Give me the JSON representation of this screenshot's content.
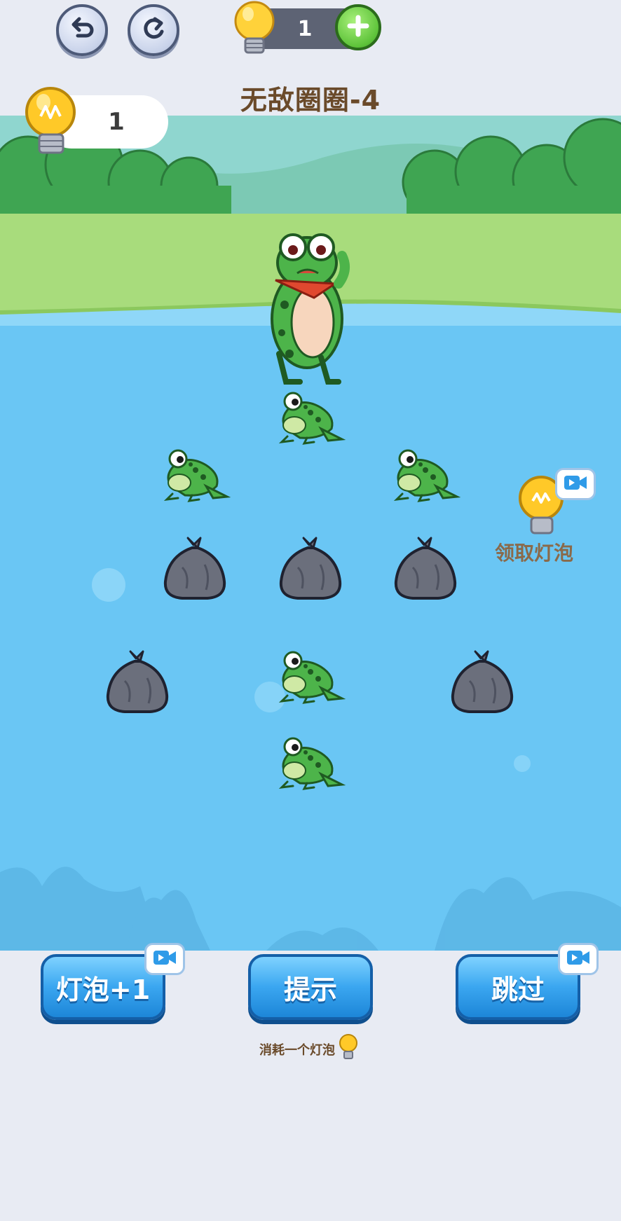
{
  "top_bar": {
    "undo_icon": "undo-arrow-icon",
    "redo_icon": "redo-arrow-icon",
    "bulb_count": "1",
    "add_icon": "plus-icon"
  },
  "level": {
    "title": "无敌圈圈-4"
  },
  "bulb_panel": {
    "count": "1",
    "icon": "lightbulb-icon"
  },
  "board": {
    "pieces": [
      {
        "kind": "frog"
      },
      {
        "kind": "frog"
      },
      {
        "kind": "frog"
      },
      {
        "kind": "bag"
      },
      {
        "kind": "bag"
      },
      {
        "kind": "bag"
      },
      {
        "kind": "bag"
      },
      {
        "kind": "frog"
      },
      {
        "kind": "bag"
      },
      {
        "kind": "frog"
      }
    ]
  },
  "claim_bulb": {
    "label": "领取灯泡",
    "icon": "video-icon"
  },
  "buttons": {
    "add_bulb": "灯泡+1",
    "hint": "提示",
    "skip": "跳过",
    "hint_note": "消耗一个灯泡"
  },
  "colors": {
    "water": "#6ac6f4",
    "grass": "#a8dc7c",
    "button_blue": "#3aa6f0",
    "title_brown": "#6a4a2a"
  }
}
